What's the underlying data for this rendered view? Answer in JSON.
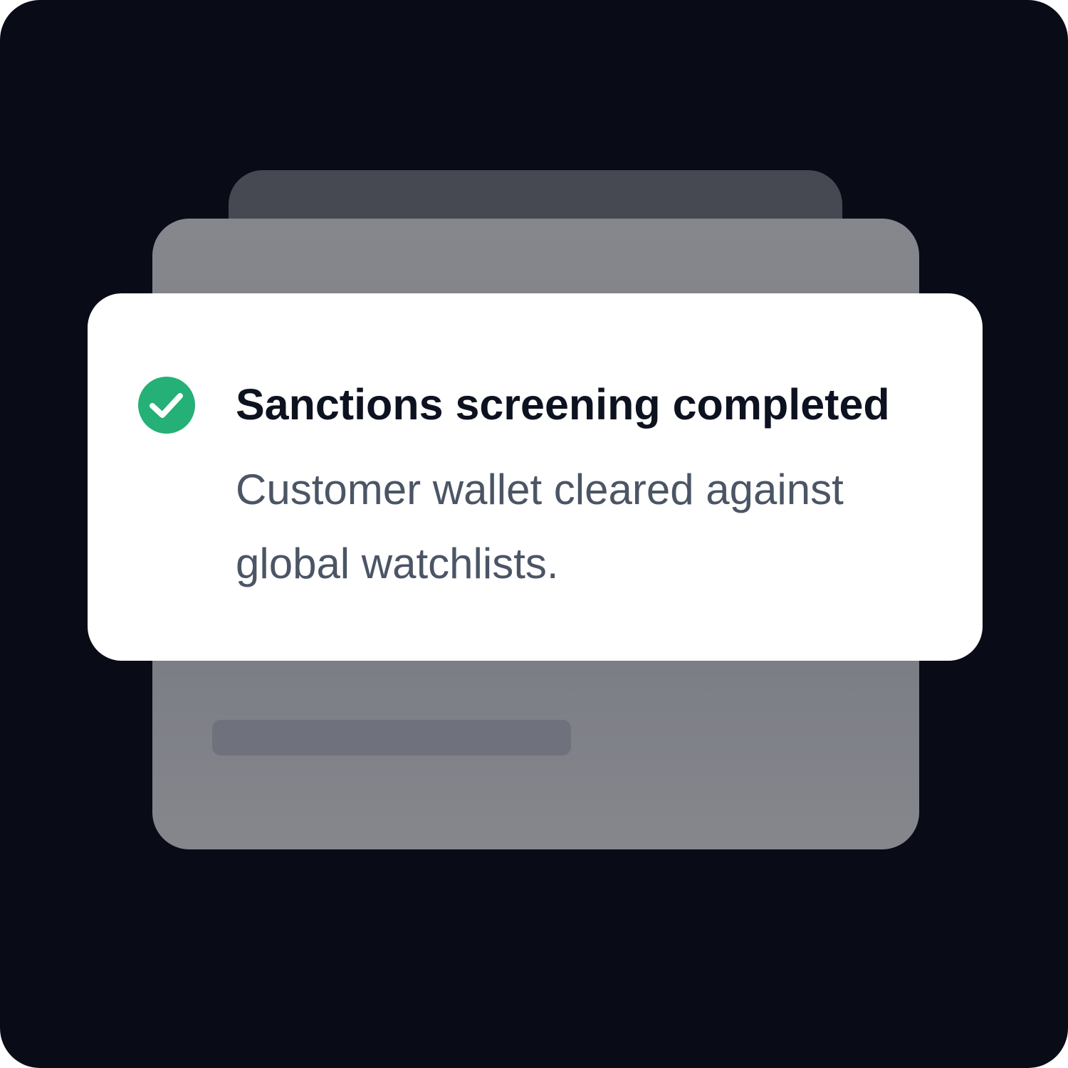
{
  "notification": {
    "status": "success",
    "status_icon": "check-circle-icon",
    "status_color": "#24b077",
    "title": "Sanctions screening completed",
    "message": "Customer wallet cleared against global watchlists."
  },
  "colors": {
    "background": "#090c17",
    "back_card": "#464952",
    "mid_card": "#86878c",
    "toast": "#ffffff",
    "title_text": "#0d1220",
    "message_text": "#4b5565"
  }
}
